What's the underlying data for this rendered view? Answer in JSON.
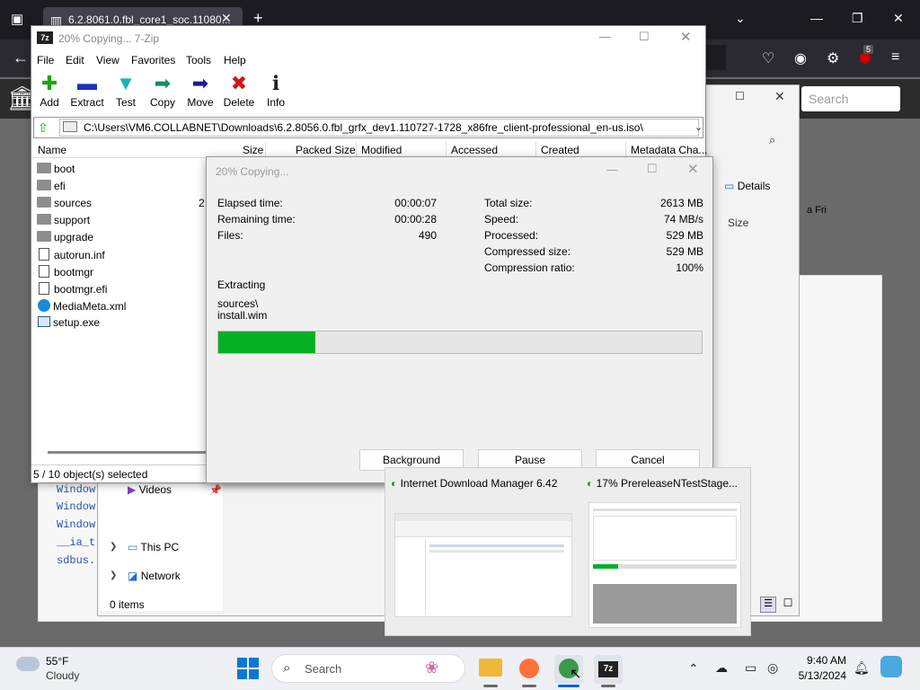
{
  "browser": {
    "tab_title": "6.2.8061.0.fbl_core1_soc.11080...",
    "ublock_count": "5",
    "search_placeholder": "Search",
    "code_lines": [
      "Window",
      "Window",
      "Window",
      "__ia_t",
      "sdbus."
    ]
  },
  "explorer": {
    "details_label": "Details",
    "size_col": "Size",
    "fri_label": "a Fri",
    "nav_items": [
      {
        "label": "Videos",
        "icon": "videos-icon"
      },
      {
        "label": "This PC",
        "icon": "pc-icon"
      },
      {
        "label": "Network",
        "icon": "network-icon"
      }
    ],
    "status": "0 items"
  },
  "sevenzip": {
    "title": "20% Copying... 7-Zip",
    "icon_text": "7z",
    "menu": [
      "File",
      "Edit",
      "View",
      "Favorites",
      "Tools",
      "Help"
    ],
    "toolbar": [
      {
        "label": "Add",
        "icon": "add-icon",
        "color": "#1aa51a",
        "glyph": "✚"
      },
      {
        "label": "Extract",
        "icon": "extract-icon",
        "color": "#1c2fbf",
        "glyph": "▬"
      },
      {
        "label": "Test",
        "icon": "test-icon",
        "color": "#18b3b3",
        "glyph": "▼"
      },
      {
        "label": "Copy",
        "icon": "copy-icon",
        "color": "#1a8a6a",
        "glyph": "➡"
      },
      {
        "label": "Move",
        "icon": "move-icon",
        "color": "#1a1aa0",
        "glyph": "➡"
      },
      {
        "label": "Delete",
        "icon": "delete-icon",
        "color": "#d01818",
        "glyph": "✖"
      },
      {
        "label": "Info",
        "icon": "info-icon",
        "color": "#222222",
        "glyph": "ℹ"
      }
    ],
    "path": "C:\\Users\\VM6.COLLABNET\\Downloads\\6.2.8056.0.fbl_grfx_dev1.110727-1728_x86fre_client-professional_en-us.iso\\",
    "columns": [
      "Name",
      "Size",
      "Packed Size",
      "Modified",
      "Accessed",
      "Created",
      "Metadata Cha..."
    ],
    "files": [
      {
        "name": "boot",
        "type": "folder"
      },
      {
        "name": "efi",
        "type": "folder"
      },
      {
        "name": "sources",
        "type": "folder",
        "size_fragment": "2"
      },
      {
        "name": "support",
        "type": "folder"
      },
      {
        "name": "upgrade",
        "type": "folder"
      },
      {
        "name": "autorun.inf",
        "type": "file"
      },
      {
        "name": "bootmgr",
        "type": "file"
      },
      {
        "name": "bootmgr.efi",
        "type": "file"
      },
      {
        "name": "MediaMeta.xml",
        "type": "edge"
      },
      {
        "name": "setup.exe",
        "type": "exe"
      }
    ],
    "status": "5 / 10 object(s) selected"
  },
  "copy_dialog": {
    "title": "20% Copying...",
    "left": [
      {
        "label": "Elapsed time:",
        "value": "00:00:07"
      },
      {
        "label": "Remaining time:",
        "value": "00:00:28"
      },
      {
        "label": "Files:",
        "value": "490"
      }
    ],
    "right": [
      {
        "label": "Total size:",
        "value": "2613 MB"
      },
      {
        "label": "Speed:",
        "value": "74 MB/s"
      },
      {
        "label": "Processed:",
        "value": "529 MB"
      },
      {
        "label": "Compressed size:",
        "value": "529 MB"
      },
      {
        "label": "Compression ratio:",
        "value": "100%"
      }
    ],
    "operation": "Extracting",
    "current_dir": "sources\\",
    "current_file": "install.wim",
    "progress": 0.2,
    "buttons": {
      "background": "Background",
      "pause": "Pause",
      "cancel": "Cancel"
    }
  },
  "thumbnails": [
    {
      "title": "Internet Download Manager 6.42",
      "icon": "idm-icon"
    },
    {
      "title": "17% PrereleaseNTestStage...",
      "icon": "idm-download-icon"
    }
  ],
  "taskbar": {
    "temp": "55°F",
    "condition": "Cloudy",
    "search": "Search",
    "time": "9:40 AM",
    "date": "5/13/2024"
  }
}
